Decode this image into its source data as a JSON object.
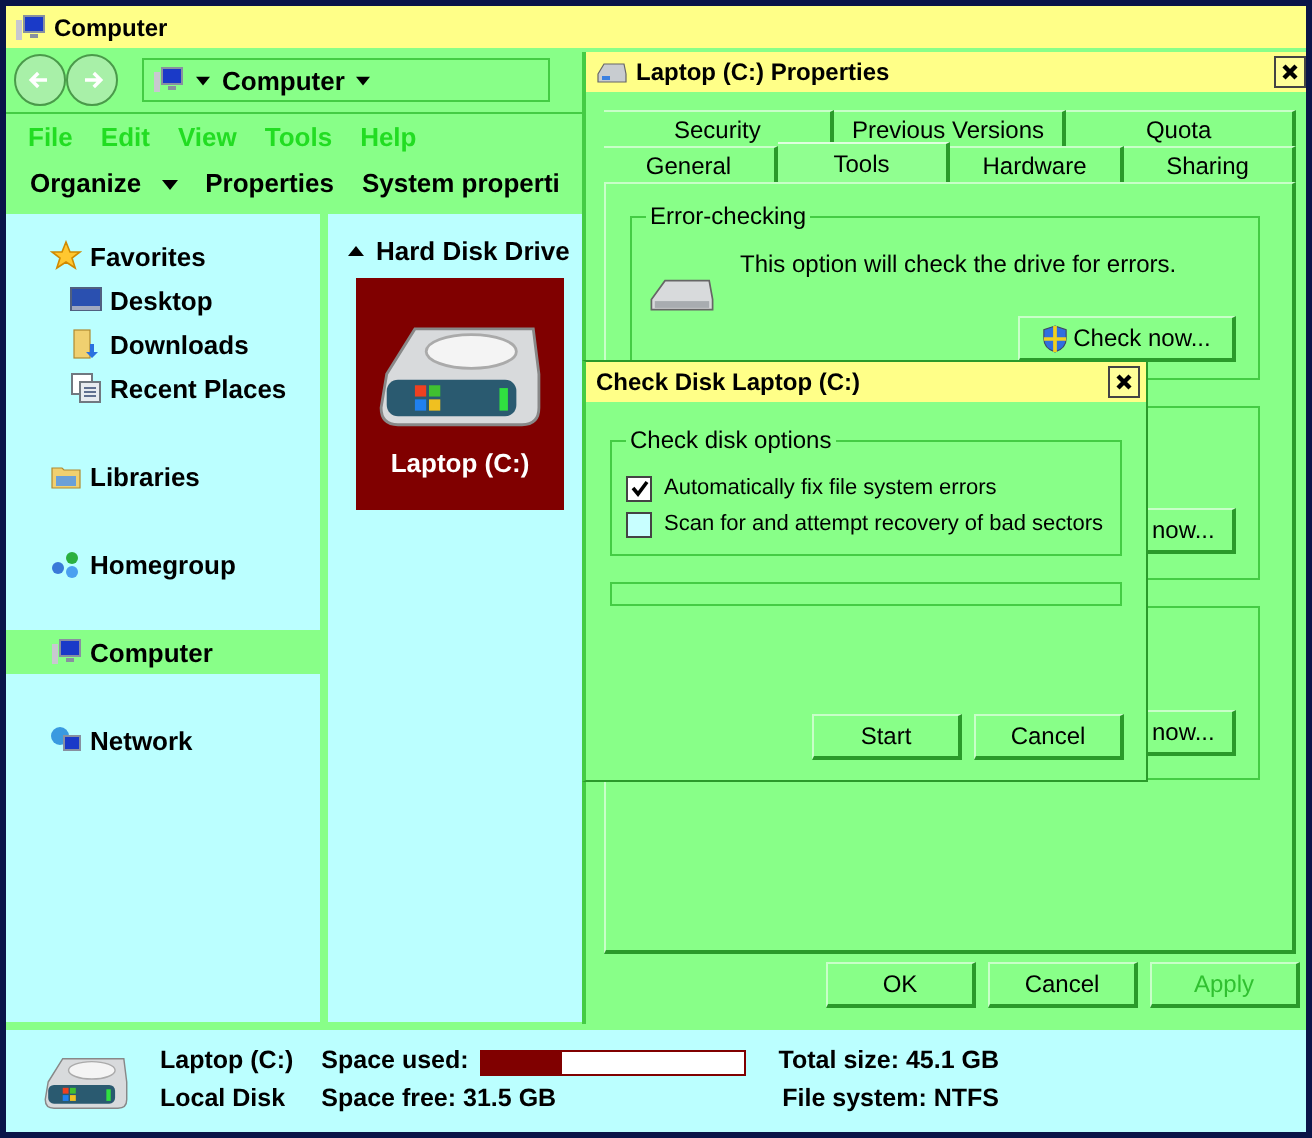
{
  "window": {
    "title": "Computer"
  },
  "address_bar": {
    "path": "Computer"
  },
  "menu": [
    "File",
    "Edit",
    "View",
    "Tools",
    "Help"
  ],
  "toolbar": [
    {
      "label": "Organize",
      "dropdown": true
    },
    {
      "label": "Properties",
      "dropdown": false
    },
    {
      "label": "System properti",
      "dropdown": false
    }
  ],
  "sidebar": [
    {
      "label": "Favorites",
      "selected": false,
      "children": [
        {
          "label": "Desktop",
          "selected": false
        },
        {
          "label": "Downloads",
          "selected": false
        },
        {
          "label": "Recent Places",
          "selected": false
        }
      ]
    },
    {
      "label": "Libraries",
      "selected": false
    },
    {
      "label": "Homegroup",
      "selected": false
    },
    {
      "label": "Computer",
      "selected": true
    },
    {
      "label": "Network",
      "selected": false
    }
  ],
  "content": {
    "group_title": "Hard Disk Drive",
    "drives": [
      {
        "label": "Laptop (C:)",
        "selected": true
      }
    ]
  },
  "status_bar": {
    "name": "Laptop (C:)",
    "type": "Local Disk",
    "space_used": {
      "label": "Space used:",
      "level": 0.3
    },
    "space_free": "Space free: 31.5 GB",
    "total_size": "Total size: 45.1 GB",
    "file_system": "File system: NTFS"
  },
  "properties_dialog": {
    "title": "Laptop (C:) Properties",
    "tab_rows": [
      [
        {
          "label": "Security",
          "selected": false
        },
        {
          "label": "Previous Versions",
          "selected": false
        },
        {
          "label": "Quota",
          "selected": false
        }
      ],
      [
        {
          "label": "General",
          "selected": false
        },
        {
          "label": "Tools",
          "selected": true
        },
        {
          "label": "Hardware",
          "selected": false
        },
        {
          "label": "Sharing",
          "selected": false
        }
      ]
    ],
    "error_checking": {
      "legend": "Error-checking",
      "text": "This option will check the drive for errors.",
      "button": "Check now..."
    },
    "covered_buttons": [
      "now...",
      "now..."
    ],
    "buttons": [
      {
        "label": "OK",
        "disabled": false
      },
      {
        "label": "Cancel",
        "disabled": false
      },
      {
        "label": "Apply",
        "disabled": true
      }
    ]
  },
  "check_disk_dialog": {
    "title": "Check Disk Laptop (C:)",
    "legend": "Check disk options",
    "options": [
      {
        "label": "Automatically fix file system errors",
        "checked": true
      },
      {
        "label": "Scan for and attempt recovery of bad sectors",
        "checked": false
      }
    ],
    "progress": {
      "level": 0
    },
    "buttons": [
      {
        "label": "Start"
      },
      {
        "label": "Cancel"
      }
    ]
  }
}
